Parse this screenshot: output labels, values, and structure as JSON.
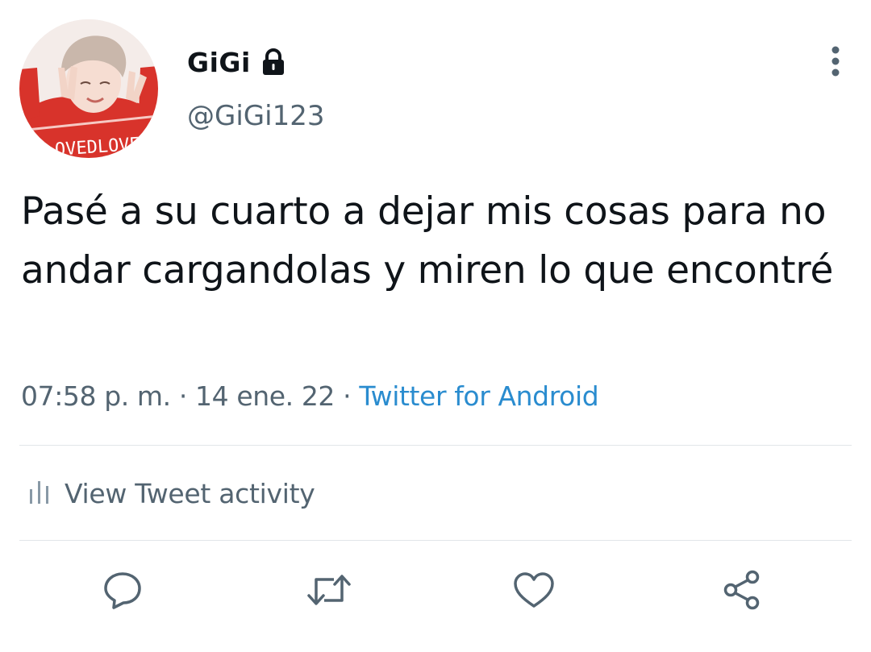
{
  "user": {
    "display_name": "GiGi",
    "handle": "@GiGi123",
    "protected": true,
    "avatar_lettering": "OVEDLOVE"
  },
  "tweet": {
    "text": "Pasé a su cuarto a dejar mis cosas para no andar cargandolas y miren lo que encontré",
    "time": "07:58 p. m.",
    "separator": "·",
    "date": "14 ene. 22",
    "source": "Twitter for Android"
  },
  "activity": {
    "label": "View Tweet activity",
    "icon": "bar-chart-icon"
  },
  "actions": [
    {
      "name": "reply",
      "icon": "reply-icon"
    },
    {
      "name": "retweet",
      "icon": "retweet-icon"
    },
    {
      "name": "like",
      "icon": "heart-icon"
    },
    {
      "name": "share",
      "icon": "share-icon"
    }
  ],
  "colors": {
    "text_primary": "#0f1419",
    "text_secondary": "#536471",
    "link": "#2a8ccf",
    "divider": "#e2e6e9",
    "icon": "#536471"
  }
}
